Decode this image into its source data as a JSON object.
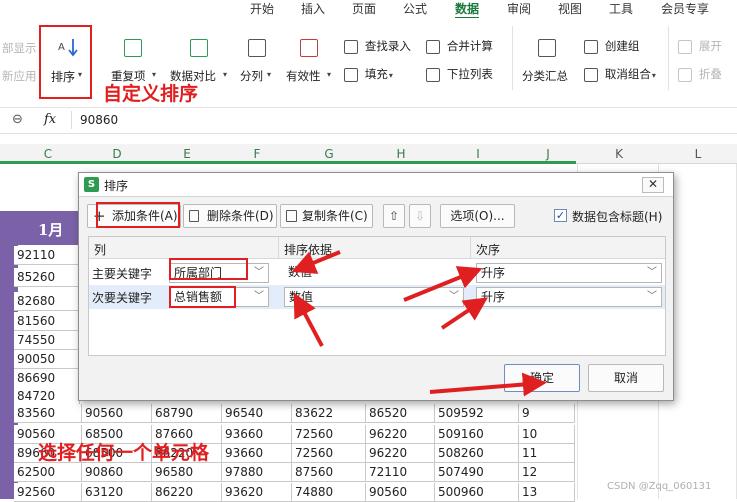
{
  "ribbon_tabs": [
    "开始",
    "插入",
    "页面",
    "公式",
    "数据",
    "审阅",
    "视图",
    "工具",
    "会员专享"
  ],
  "ribbon": {
    "left_labels": [
      "部显示",
      "新应用"
    ],
    "sort": "排序",
    "dedupe": "重复项",
    "compare": "数据对比",
    "split": "分列",
    "validity": "有效性",
    "find_entry": "查找录入",
    "fill": "填充",
    "consolidate": "合并计算",
    "dropdown": "下拉列表",
    "subtotal": "分类汇总",
    "create_group": "创建组",
    "ungroup": "取消组合",
    "expand": "展开",
    "collapse": "折叠"
  },
  "formula_bar": {
    "fx": "fx",
    "value": "90860"
  },
  "columns": [
    "C",
    "D",
    "E",
    "F",
    "G",
    "H",
    "I",
    "J",
    "K",
    "L"
  ],
  "left_header": "1月",
  "left_column": [
    "92110",
    "85260",
    "82680",
    "81560",
    "74550",
    "90050",
    "86690",
    "84720"
  ],
  "bottom_rows": [
    [
      "83560",
      "90560",
      "68790",
      "96540",
      "83622",
      "86520",
      "509592",
      "9"
    ],
    [
      "90560",
      "68500",
      "87660",
      "93660",
      "72560",
      "96220",
      "509160",
      "10"
    ],
    [
      "89660",
      "68500",
      "86220",
      "93660",
      "72560",
      "96220",
      "508260",
      "11"
    ],
    [
      "62500",
      "90860",
      "96580",
      "97880",
      "87560",
      "72110",
      "507490",
      "12"
    ],
    [
      "92560",
      "63120",
      "86220",
      "93620",
      "74880",
      "90560",
      "500960",
      "13"
    ]
  ],
  "dialog": {
    "title": "排序",
    "add_condition": "添加条件(A)",
    "delete_condition": "删除条件(D)",
    "copy_condition": "复制条件(C)",
    "options": "选项(O)...",
    "has_header": "数据包含标题(H)",
    "col_header": "列",
    "basis_header": "排序依据",
    "order_header": "次序",
    "row1_label": "主要关键字",
    "row1_key": "所属部门",
    "row1_basis": "数值",
    "row1_order": "升序",
    "row2_label": "次要关键字",
    "row2_key": "总销售额",
    "row2_basis": "数值",
    "row2_order": "升序",
    "ok": "确定",
    "cancel": "取消"
  },
  "annotations": {
    "custom_sort": "自定义排序",
    "select_cell": "选择任何一个单元格"
  },
  "watermark": "CSDN @Zqq_060131",
  "colors": {
    "accent_green": "#1a7a3a",
    "annotation_red": "#e02020",
    "header_purple": "#7b62a8"
  }
}
